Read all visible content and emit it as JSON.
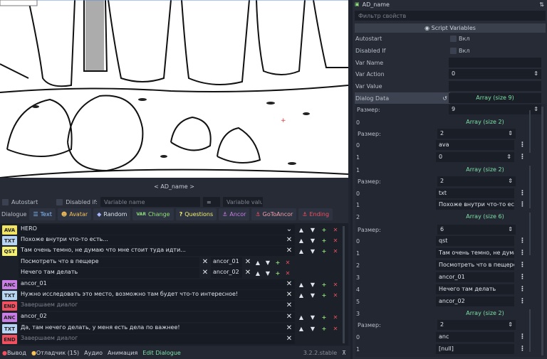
{
  "viewport": {
    "label": "< AD_name >"
  },
  "filter": {
    "autostart": "Autostart",
    "disabled_if": "Disabled if:",
    "var_placeholder": "Variable name",
    "op": "=",
    "val_placeholder": "Variable valu"
  },
  "toolbar": {
    "dialogue": "Dialogue",
    "text": "Text",
    "avatar": "Avatar",
    "random": "Random",
    "change": "Change",
    "questions": "Questions",
    "ancor": "Ancor",
    "gotoancor": "GoToAncor",
    "ending": "Ending"
  },
  "rows": [
    {
      "tag": "AVA",
      "color": "#f1e463",
      "text": "HERO",
      "dropdown": true
    },
    {
      "tag": "TXT",
      "color": "#b7d4f2",
      "text": "Похоже внутри что-то есть..."
    },
    {
      "tag": "QST",
      "color": "#f5f174",
      "text": "Там очень темно, не думаю что мне стоит туда идти..."
    },
    {
      "tag": "ANC",
      "color": "#c97ee5",
      "text": "ancor_01"
    },
    {
      "tag": "TXT",
      "color": "#b7d4f2",
      "text": "Нужно исследовать это место, возможно там будет что-то интересное!"
    },
    {
      "tag": "END",
      "color": "#f05060",
      "text": "Завершаем диалог"
    },
    {
      "tag": "ANC",
      "color": "#c97ee5",
      "text": "ancor_02"
    },
    {
      "tag": "TXT",
      "color": "#b7d4f2",
      "text": "Да, там нечего делать, у меня есть дела по важнее!"
    },
    {
      "tag": "END",
      "color": "#f05060",
      "text": "Завершаем диалог"
    }
  ],
  "answers": [
    {
      "text": "Посмотреть что в пещере",
      "anchor": "ancor_01"
    },
    {
      "text": "Нечего там делать",
      "anchor": "ancor_02"
    }
  ],
  "bottom": {
    "output": "Вывод",
    "debugger": "Отладчик (15)",
    "audio": "Аудио",
    "animation": "Анимация",
    "edit": "Edit Dialogue",
    "version": "3.2.2.stable"
  },
  "inspector": {
    "title": "AD_name",
    "filter": "Фильтр свойств",
    "section": "Script Variables",
    "autostart": "Autostart",
    "autostart_val": "Вкл",
    "disabled_if": "Disabled If",
    "disabled_val": "Вкл",
    "var_name": "Var Name",
    "var_action": "Var Action",
    "var_action_val": "0",
    "var_value": "Var Value",
    "dialog_data": "Dialog Data",
    "array9": "Array (size 9)",
    "size_label": "Размер:",
    "size9": "9",
    "i0": "0",
    "i1": "1",
    "i2": "2",
    "i3": "3",
    "i4": "4",
    "i5": "5",
    "array2": "Array (size 2)",
    "size2": "2",
    "ava": "ava",
    "zero": "0",
    "txt": "txt",
    "txt_val": "Похоже внутри что-то есть",
    "array6": "Array (size 6)",
    "size6": "6",
    "qst": "qst",
    "q1": "Там очень темно, не дума",
    "q2": "Посмотреть что в пещере",
    "q3": "ancor_01",
    "q4": "Нечего там делать",
    "q5": "ancor_02",
    "anc": "anc",
    "null": "[null]"
  }
}
